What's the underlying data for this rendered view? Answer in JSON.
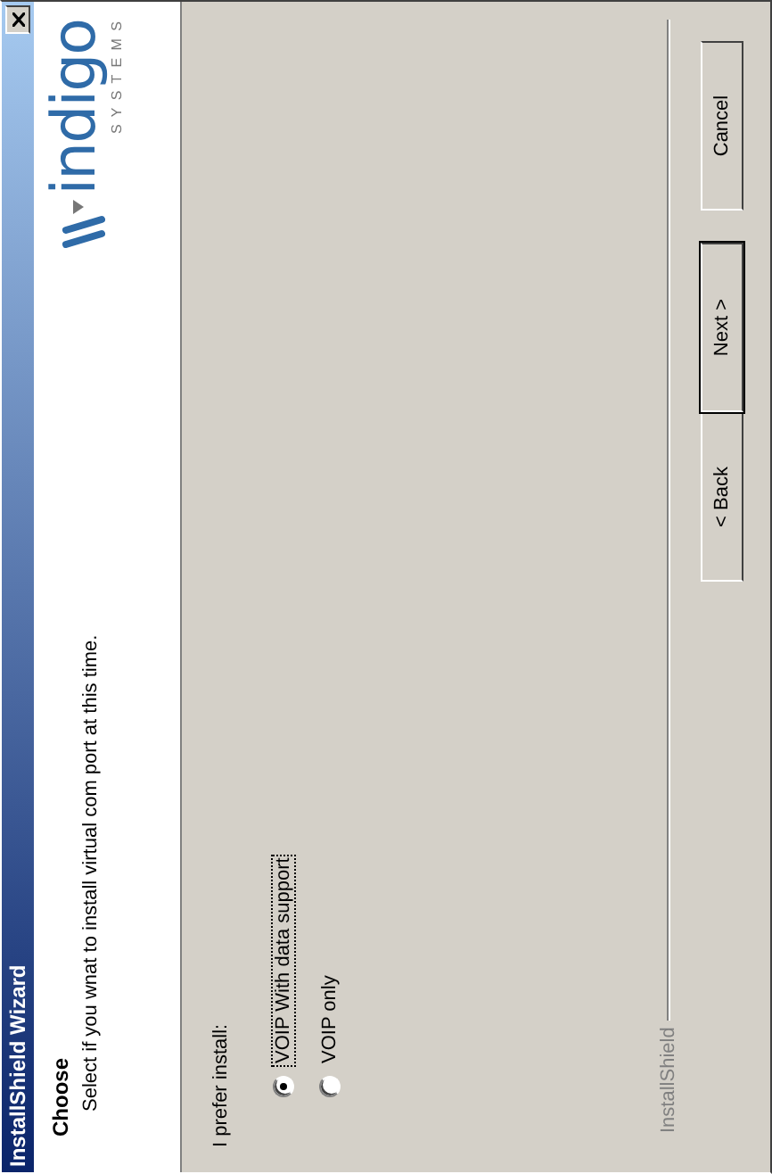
{
  "window": {
    "title": "InstallShield Wizard"
  },
  "header": {
    "title": "Choose",
    "subtitle": "Select if you wnat to install virtual com port at this time.",
    "logo": {
      "text": "indigo",
      "tagline": "S Y S T E M S"
    }
  },
  "prompt": "I prefer install:",
  "options": [
    {
      "label": "VOIP With data support",
      "selected": true,
      "focused": true
    },
    {
      "label": "VOIP only",
      "selected": false,
      "focused": false
    }
  ],
  "footer_label": "InstallShield",
  "buttons": [
    {
      "label": "< Back",
      "default": false
    },
    {
      "label": "Next >",
      "default": true
    },
    {
      "label": "Cancel",
      "default": false
    }
  ]
}
